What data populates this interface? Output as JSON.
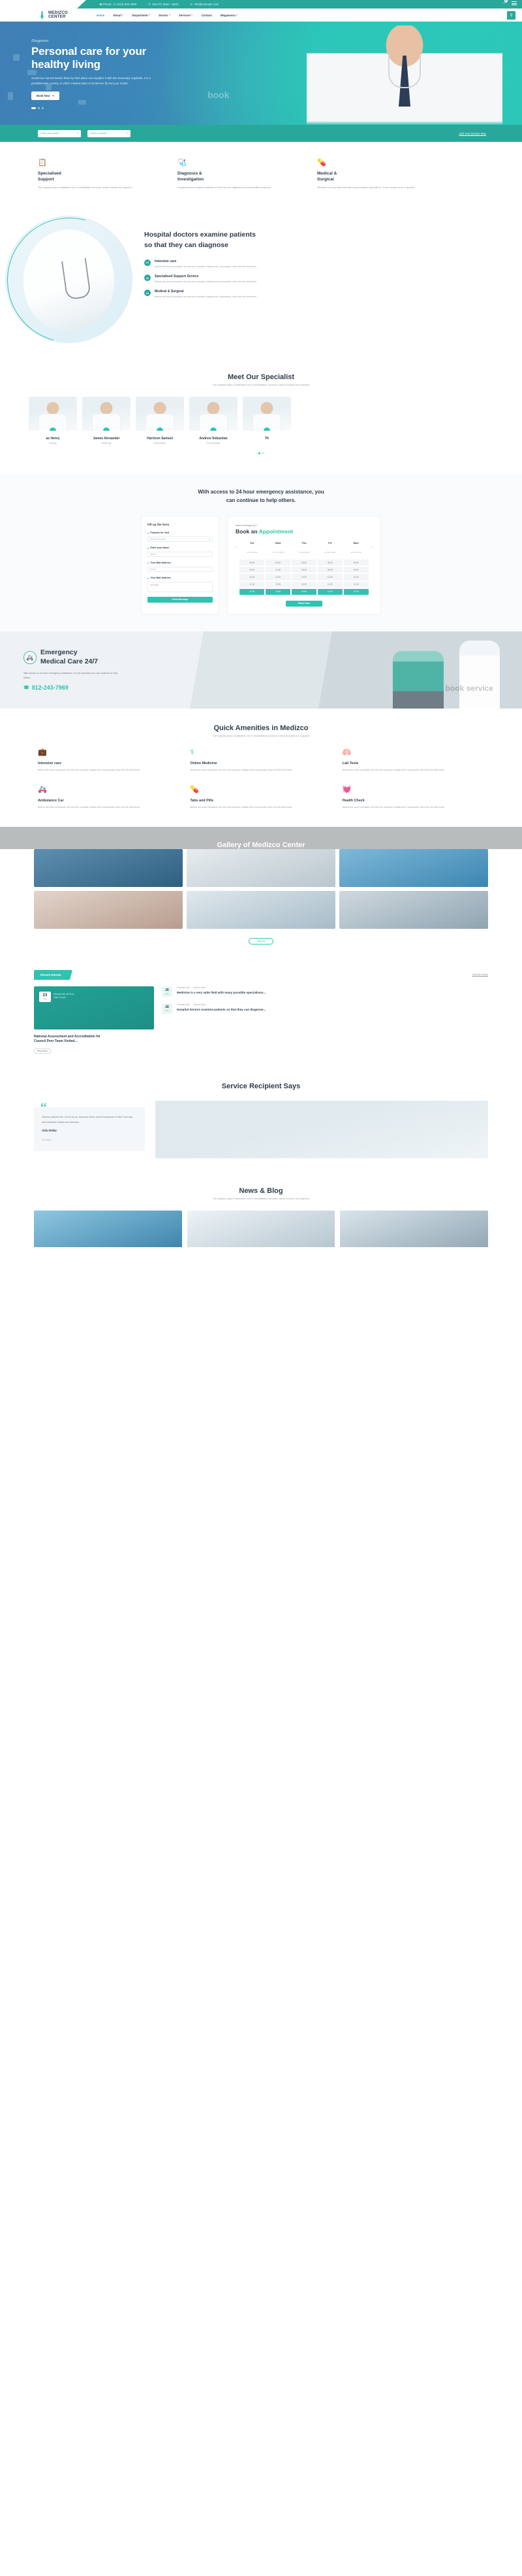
{
  "topbar": {
    "phone": "Phone: +1 (212) 305-2500",
    "hours": "Mon-Fri (8am - 6pm)",
    "email": "info@example.com",
    "cart_count": "0",
    "phone_icon": "phone-icon",
    "clock_icon": "clock-icon",
    "mail_icon": "envelope-icon",
    "cart_icon": "cart-icon",
    "menu_icon": "hamburger-icon"
  },
  "brand": {
    "line1": "MEDIZCO",
    "line2": "CENTER",
    "icon": "caduceus-logo-icon"
  },
  "nav": {
    "items": [
      {
        "label": "Home",
        "caret": false,
        "active": true
      },
      {
        "label": "About",
        "caret": true,
        "active": false
      },
      {
        "label": "Department",
        "caret": true,
        "active": false
      },
      {
        "label": "Doctor",
        "caret": true,
        "active": false
      },
      {
        "label": "Services",
        "caret": true,
        "active": false
      },
      {
        "label": "Contact",
        "caret": false,
        "active": false
      },
      {
        "label": "Megamenu",
        "caret": true,
        "active": false
      }
    ],
    "search_icon": "search-icon"
  },
  "hero": {
    "eyebrow": "Diagnosis",
    "title_line1": "Personal care for your",
    "title_line2": "healthy living",
    "paragraph": "Small river named Duden flows by their place and supplies it with the necessary regelialia. It is a paradisematic country, in which roasted parts of sentences fly into your mouth.",
    "button": "Book Now",
    "button_icon": "arrow-right-icon",
    "watermark": "book"
  },
  "searchstrip": {
    "fields": [
      {
        "placeholder": "Enter your name",
        "icon": "chevron-down-icon"
      },
      {
        "placeholder": "Select a doctor",
        "icon": "chevron-down-icon"
      }
    ],
    "link": "Add Your Service Now"
  },
  "services": [
    {
      "icon": "clipboard-icon",
      "title_line1": "Specialised",
      "title_line2": "Support",
      "text": "The hospital plays a statewide role in rehabilitation services, which includes the Acquired"
    },
    {
      "icon": "stethoscope-icon",
      "title_line1": "Diagnosis &",
      "title_line2": "Investigation",
      "text": "Hospital doctors examine patients so that they can diagnose and treat health conditions."
    },
    {
      "icon": "medical-kit-icon",
      "title_line1": "Medical &",
      "title_line2": "Surgical",
      "text": "Medicine is a very wide field with many possible specialisms. Some doctors work in general"
    }
  ],
  "examine": {
    "title_line1": "Hospital doctors examine patients",
    "title_line2": "so that they can diagnose",
    "items": [
      {
        "badge": "01",
        "title": "Intensive care",
        "text": "Behind the word mountains, far from the countries Vokalia and Consonantia, there live the blind texts."
      },
      {
        "badge": "02",
        "title": "Specialised Support Service",
        "text": "Behind the word mountains, far from the countries Vokalia and Consonantia, there live the blind texts."
      },
      {
        "badge": "03",
        "title": "Medical & Surgical",
        "text": "Behind the word mountains, far from the countries Vokalia and Consonantia, there live the blind texts."
      }
    ]
  },
  "specialists": {
    "title": "Meet Our Specialist",
    "subtitle": "The hospital plays a statewide role in rehabilitation services, which includes the Acquired",
    "doctors": [
      {
        "name": "as Henry",
        "role": "rdiology"
      },
      {
        "name": "James Alexander",
        "role": "Radiology"
      },
      {
        "name": "Harrison Samuel",
        "role": "Anaesthetics"
      },
      {
        "name": "Andrew Sebastian",
        "role": "Dermatologist"
      },
      {
        "name": "Th",
        "role": ""
      }
    ]
  },
  "appointment": {
    "heading_line1": "With access to 24 hour emergency assistance, you",
    "heading_line2": "can continue to help others.",
    "form": {
      "title": "Fill up the form",
      "fields": [
        {
          "label": "Purpose for Visit",
          "value": "Select a Service",
          "icon": "chevron-down-icon"
        },
        {
          "label": "Enter your Name",
          "value": "Name",
          "icon": ""
        },
        {
          "label": "Your Mail Address",
          "value": "Email",
          "icon": ""
        },
        {
          "label": "Your Mail Address",
          "value": "Message",
          "icon": ""
        }
      ],
      "submit": "Send Message"
    },
    "booking": {
      "eyebrow": "Need emergency?",
      "title_prefix": "Book an ",
      "title_accent": "Appointment",
      "prev_icon": "chevron-left-icon",
      "next_icon": "chevron-right-icon",
      "days": [
        {
          "day": "Tue",
          "date": "11 Oct 2018"
        },
        {
          "day": "Wed",
          "date": "12 Oct 2018"
        },
        {
          "day": "Thu",
          "date": "13 Oct 2018"
        },
        {
          "day": "Fri",
          "date": "14 Oct 2018"
        },
        {
          "day": "Mon",
          "date": "10 Oct 2018"
        }
      ],
      "slots": [
        [
          "08:30",
          "09:00",
          "08:30",
          "08:30",
          "08:30"
        ],
        [
          "09:30",
          "10:00",
          "09:30",
          "09:30",
          "09:30"
        ],
        [
          "10:30",
          "11:00",
          "10:30",
          "10:30",
          "10:30"
        ],
        [
          "11:30",
          "12:00",
          "11:30",
          "11:30",
          "11:30"
        ],
        [
          "12:30",
          "13:00",
          "12:30",
          "12:30",
          "12:30"
        ]
      ],
      "selected_row": 4,
      "button": "Book Now"
    }
  },
  "emergency": {
    "icon": "ambulance-icon",
    "title_line1": "Emergency",
    "title_line2": "Medical Care 24/7",
    "text": "With access to 24 hour emergency assistance, it's an important you can continue to help others.",
    "phone_icon": "phone-icon",
    "phone": "812-243-7969",
    "watermark": "book service"
  },
  "amenities": {
    "title": "Quick Amenities in Medizco",
    "subtitle": "The hospital plays a statewide role in rehabilitation services, which includes the Acquired",
    "items": [
      {
        "icon": "medical-bag-icon",
        "title": "Intensive care",
        "text": "Behind the word mountains, far from the countries Vokalia and Consonantia, there live the blind texts."
      },
      {
        "icon": "caduceus-icon",
        "title": "Online Medicine",
        "text": "Behind the word mountains, far from the countries Vokalia and Consonantia, there live the blind texts."
      },
      {
        "icon": "lungs-icon",
        "title": "Lab Tests",
        "text": "Behind the word mountains, far from the countries Vokalia and Consonantia, there live the blind texts."
      },
      {
        "icon": "ambulance-icon",
        "title": "Ambulance Car",
        "text": "Behind the word mountains, far from the countries Vokalia and Consonantia, there live the blind texts."
      },
      {
        "icon": "pills-icon",
        "title": "Tabs and Pills",
        "text": "Behind the word mountains, far from the countries Vokalia and Consonantia, there live the blind texts."
      },
      {
        "icon": "heartbeat-icon",
        "title": "Health Check",
        "text": "Behind the word mountains, far from the countries Vokalia and Consonantia, there live the blind texts."
      }
    ]
  },
  "gallery": {
    "title": "Gallery of Medizco Center",
    "button": "View All",
    "tiles": [
      {
        "name": "surgeons-operating"
      },
      {
        "name": "patient-arm-examination"
      },
      {
        "name": "blue-gloved-hands"
      },
      {
        "name": "child-patient-checkup"
      },
      {
        "name": "doctor-with-tablet"
      },
      {
        "name": "nurse-with-patient"
      }
    ]
  },
  "events": {
    "tab": "Recent Events",
    "view_all": "View All Events",
    "featured": {
      "day": "23",
      "month": "Sep",
      "meta_location": "Sharing Hall, 9th Floor",
      "meta_time": "10am to 2pm",
      "title_line1": "National Assessment and Accreditation for",
      "title_line2": "Council Peer Team Visited...",
      "button": "Read More"
    },
    "list": [
      {
        "day": "26",
        "month": "Sep",
        "meta_location": "Charlotte Hall",
        "meta_time": "10am to 3pm",
        "title": "Medicine is a very wide field with many possible specialisms..."
      },
      {
        "day": "28",
        "month": "Sep",
        "meta_location": "Charlotte Hall",
        "meta_time": "10am to 3pm",
        "title": "Hospital doctors examine patients so that they can diagnose..."
      }
    ]
  },
  "testimonial": {
    "title": "Service Recipient Says",
    "quote": "Damas adviced her not to do so, because there were thousands of bad Commas, wild Question Marks and devious.",
    "name": "Alda Stellar",
    "role": "US Citizen",
    "quote_mark": "“",
    "photo": "happy-family-portrait"
  },
  "news": {
    "title": "News & Blog",
    "subtitle": "The hospital plays a statewide role in rehabilitation services, which includes the Acquired",
    "posts": [
      {
        "image": "surgery-team-photo"
      },
      {
        "image": "doctor-with-stethoscope-photo"
      },
      {
        "image": "lab-research-photo"
      }
    ]
  },
  "colors": {
    "teal": "#2ec4b0",
    "teal_dark": "#2aa79b",
    "navy": "#2f3c4a",
    "muted": "#9aa4ad"
  }
}
